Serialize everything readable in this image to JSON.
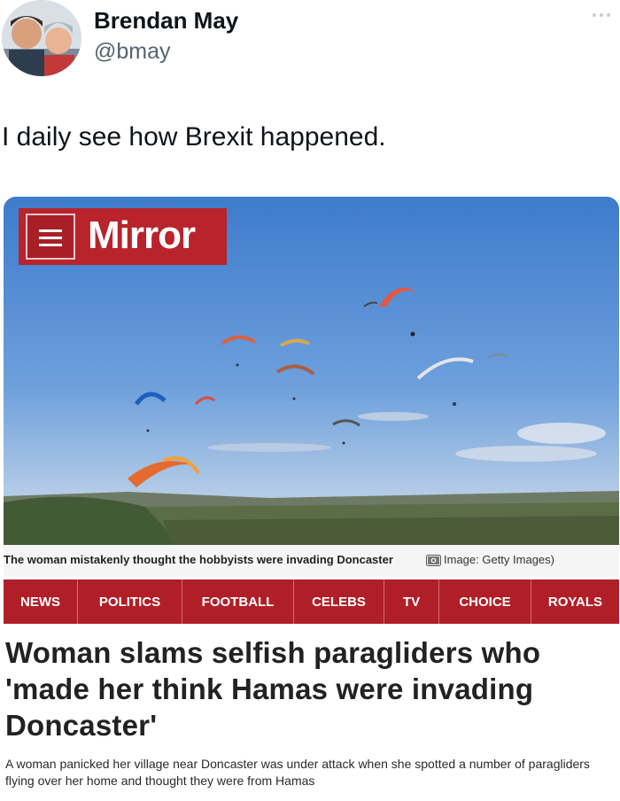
{
  "tweet": {
    "author_name": "Brendan May",
    "handle": "@bmay",
    "text": "I daily see how Brexit happened."
  },
  "article_card": {
    "logo_text": "Mirror",
    "caption": "The woman mistakenly thought the hobbyists were invading Doncaster",
    "image_credit": "Image: Getty Images)",
    "nav_items": [
      {
        "label": "NEWS"
      },
      {
        "label": "POLITICS"
      },
      {
        "label": "FOOTBALL"
      },
      {
        "label": "CELEBS"
      },
      {
        "label": "TV"
      },
      {
        "label": "CHOICE"
      },
      {
        "label": "ROYALS"
      }
    ],
    "headline": "Woman slams selfish paragliders who 'made her think Hamas were invading Doncaster'",
    "standfirst": "A woman panicked her village near Doncaster was under attack when she spotted a number of paragliders flying over her home and thought they were from Hamas"
  },
  "colors": {
    "brand_red": "#b01f28",
    "sky_top": "#3f7fd0",
    "sky_bottom": "#a9c7e6",
    "handle_gray": "#536471"
  },
  "icons": [
    "more-options-icon",
    "hamburger-menu-icon",
    "camera-icon"
  ]
}
